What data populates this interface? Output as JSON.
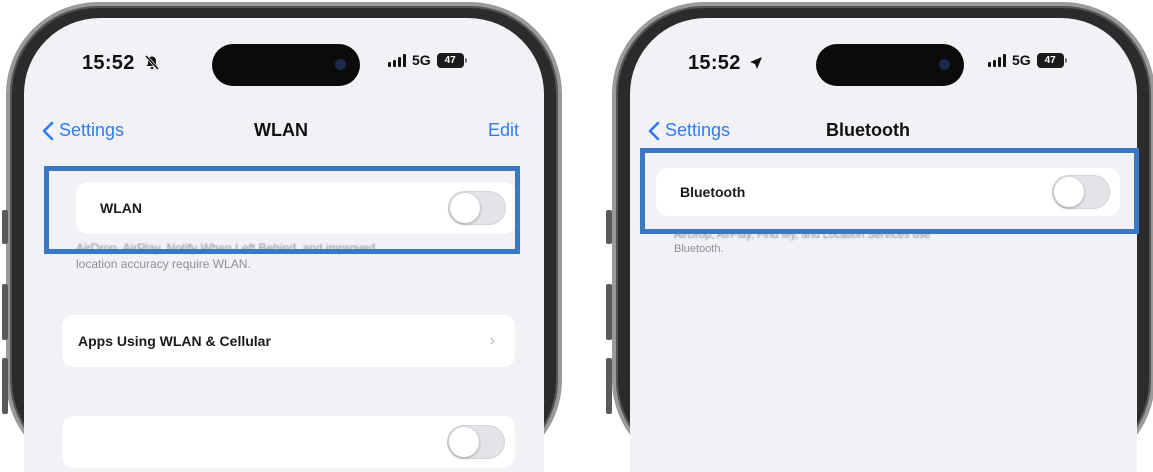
{
  "wlan_screen": {
    "status": {
      "time": "15:52",
      "network": "5G",
      "battery": "47"
    },
    "nav": {
      "back_label": "Settings",
      "title": "WLAN",
      "edit_label": "Edit"
    },
    "wlan_row": {
      "label": "WLAN",
      "toggle_on": false
    },
    "footnote": {
      "line1": "AirDrop, AirPlay, Notify When Left Behind, and improved",
      "line2": "location accuracy require WLAN."
    },
    "apps_row": {
      "label": "Apps Using WLAN & Cellular"
    },
    "bottom_row": {
      "label": "",
      "toggle_on": false
    }
  },
  "bluetooth_screen": {
    "status": {
      "time": "15:52",
      "network": "5G",
      "battery": "47"
    },
    "nav": {
      "back_label": "Settings",
      "title": "Bluetooth"
    },
    "bluetooth_row": {
      "label": "Bluetooth",
      "toggle_on": false
    },
    "footnote": {
      "line1": "AirDrop, AirPlay, Find My, and Location Services use",
      "line2": "Bluetooth."
    }
  },
  "colors": {
    "highlight": "#3a78c4",
    "ios_blue": "#2f7cf6",
    "screen_bg": "#f2f2f6",
    "toggle_off": "#e4e4e8"
  }
}
